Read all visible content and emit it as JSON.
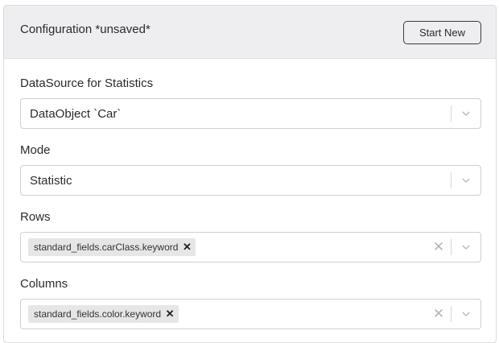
{
  "header": {
    "title": "Configuration *unsaved*",
    "start_new_label": "Start New"
  },
  "fields": {
    "datasource": {
      "label": "DataSource for Statistics",
      "value": "DataObject `Car`"
    },
    "mode": {
      "label": "Mode",
      "value": "Statistic"
    },
    "rows": {
      "label": "Rows",
      "chips": [
        "standard_fields.carClass.keyword"
      ]
    },
    "columns": {
      "label": "Columns",
      "chips": [
        "standard_fields.color.keyword"
      ]
    }
  },
  "icons": {
    "chip_remove": "close-icon",
    "clear": "clear-icon",
    "dropdown": "chevron-down-icon"
  },
  "colors": {
    "header_bg": "#eeeef1",
    "border": "#cfcfcf",
    "chip_bg": "#e6e6e6"
  }
}
